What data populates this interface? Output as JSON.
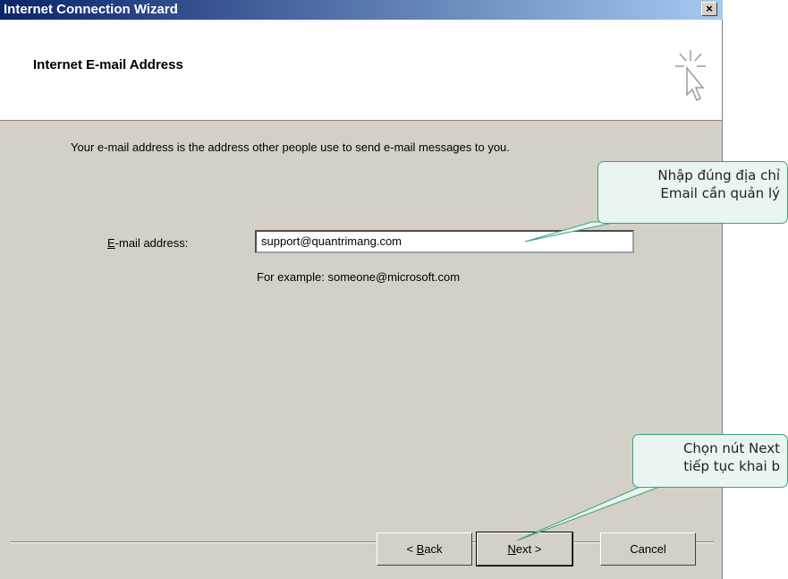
{
  "window": {
    "title": "Internet Connection Wizard",
    "close_label": "×"
  },
  "header": {
    "title": "Internet E-mail Address"
  },
  "body": {
    "description": "Your e-mail address is the address other people use to send e-mail messages to you.",
    "email_label_accel": "E",
    "email_label_rest": "-mail address:",
    "email_value": "support@quantrimang.com",
    "example": "For example: someone@microsoft.com"
  },
  "buttons": {
    "back_prefix": "< ",
    "back_accel": "B",
    "back_rest": "ack",
    "next_accel": "N",
    "next_rest": "ext >",
    "cancel": "Cancel"
  },
  "callouts": {
    "email_line1": "Nhập đúng địa chỉ",
    "email_line2": "Email cần quản lý",
    "next_line1": "Chọn nút Next",
    "next_line2": "tiếp tục khai b"
  }
}
